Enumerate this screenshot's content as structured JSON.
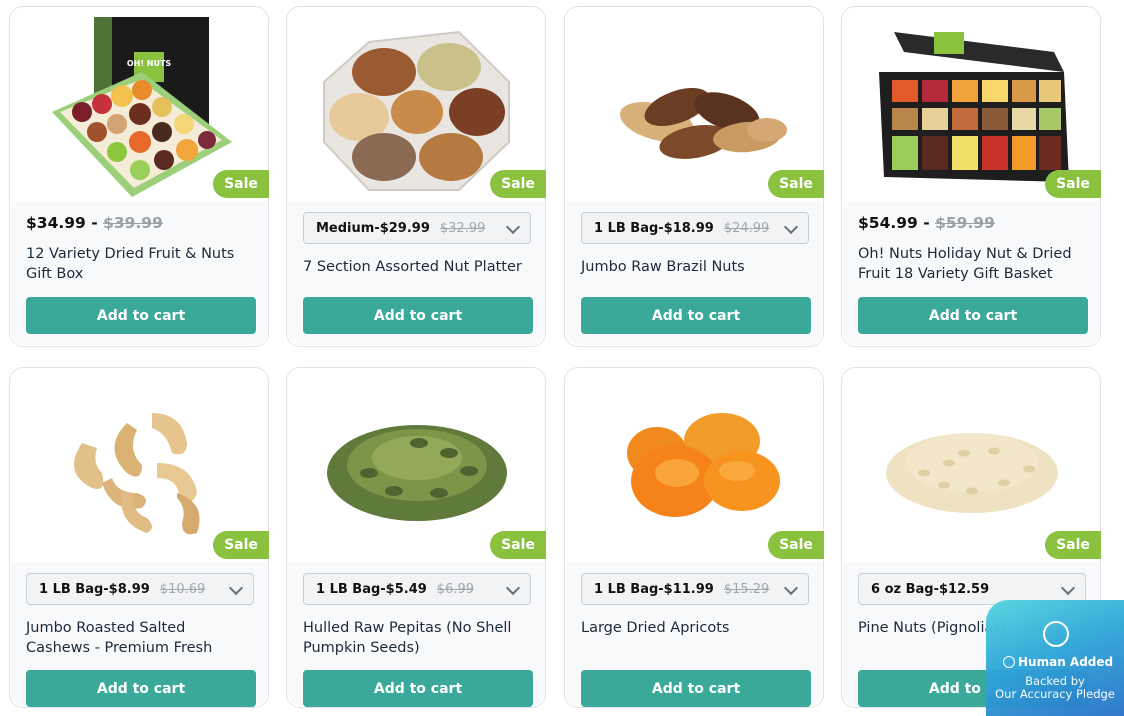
{
  "sale_label": "Sale",
  "add_to_cart_label": "Add to cart",
  "products": [
    {
      "title_line1": "12 Variety Dried Fruit & Nuts",
      "title_line2": "Gift Box",
      "price": "$34.99",
      "price_sep": " - ",
      "old_price": "$39.99"
    },
    {
      "title_line1": "7 Section Assorted Nut Platter",
      "title_line2": "",
      "option": "Medium-$29.99",
      "old_price": "$32.99"
    },
    {
      "title_line1": "Jumbo Raw Brazil Nuts",
      "title_line2": "",
      "option": "1 LB Bag-$18.99",
      "old_price": "$24.99"
    },
    {
      "title_line1": "Oh! Nuts Holiday Nut & Dried",
      "title_line2": "Fruit 18 Variety Gift Basket",
      "price": "$54.99",
      "price_sep": " - ",
      "old_price": "$59.99"
    },
    {
      "title_line1": "Jumbo Roasted Salted",
      "title_line2": "Cashews - Premium Fresh",
      "option": "1 LB Bag-$8.99",
      "old_price": "$10.69"
    },
    {
      "title_line1": "Hulled Raw Pepitas (No Shell",
      "title_line2": "Pumpkin Seeds)",
      "option": "1 LB Bag-$5.49",
      "old_price": "$6.99"
    },
    {
      "title_line1": "Large Dried Apricots",
      "title_line2": "",
      "option": "1 LB Bag-$11.99",
      "old_price": "$15.29"
    },
    {
      "title_line1": "Pine Nuts (Pignolias)",
      "title_line2": "",
      "option": "6 oz Bag-$12.59",
      "old_price": ""
    }
  ],
  "box_logo_text": "OH! NUTS",
  "badge": {
    "title": "Human Added",
    "line1": "Backed by",
    "line2": "Our Accuracy Pledge"
  },
  "colors": {
    "accent": "#3aa99a",
    "sale": "#8ac23f",
    "badge": "#2fa6d8"
  }
}
